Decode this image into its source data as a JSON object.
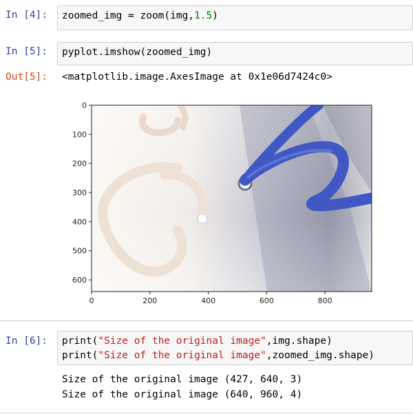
{
  "cells": {
    "cell4": {
      "prompt": "In [4]:",
      "code": [
        "zoomed_img = zoom(img,",
        "1.5",
        ")"
      ]
    },
    "cell5": {
      "prompt": "In [5]:",
      "code": "pyplot.imshow(zoomed_img)",
      "out_prompt": "Out[5]:",
      "output": "<matplotlib.image.AxesImage at 0x1e06d7424c0>"
    },
    "cell6": {
      "prompt": "In [6]:",
      "line1_a": "print(",
      "line1_str": "\"Size of the original image\"",
      "line1_b": ",img.shape)",
      "line2_a": "print(",
      "line2_str": "\"Size of the original image\"",
      "line2_b": ",zoomed_img.shape)",
      "output": [
        "Size of the original image (427, 640, 3)",
        "Size of the original image (640, 960, 4)"
      ]
    }
  },
  "chart_data": {
    "type": "image",
    "x_ticks": [
      "0",
      "200",
      "400",
      "600",
      "800"
    ],
    "y_ticks": [
      "0",
      "100",
      "200",
      "300",
      "400",
      "500",
      "600"
    ],
    "xlim": [
      0,
      960
    ],
    "ylim": [
      640,
      0
    ]
  }
}
